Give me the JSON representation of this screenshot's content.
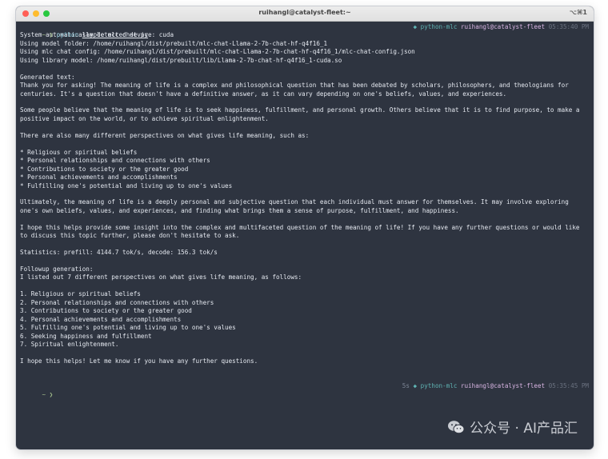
{
  "window": {
    "title": "ruihangl@catalyst-fleet:~",
    "shortcut": "⌥⌘1"
  },
  "prompt1": {
    "arrow": "~ ❯",
    "command": "python",
    "file": "sample_mlc_chat.py",
    "venv": "python-mlc",
    "user_host": "ruihangl@catalyst-fleet",
    "time": "05:35:40 PM"
  },
  "output": {
    "detect": "System automatically detected device: cuda",
    "model_folder": "Using model folder: /home/ruihangl/dist/prebuilt/mlc-chat-Llama-2-7b-chat-hf-q4f16_1",
    "chat_config": "Using mlc chat config: /home/ruihangl/dist/prebuilt/mlc-chat-Llama-2-7b-chat-hf-q4f16_1/mlc-chat-config.json",
    "library_model": "Using library model: /home/ruihangl/dist/prebuilt/lib/Llama-2-7b-chat-hf-q4f16_1-cuda.so",
    "generated_header": "Generated text:",
    "para1": "Thank you for asking! The meaning of life is a complex and philosophical question that has been debated by scholars, philosophers, and theologians for centuries. It's a question that doesn't have a definitive answer, as it can vary depending on one's beliefs, values, and experiences.",
    "para2": "Some people believe that the meaning of life is to seek happiness, fulfillment, and personal growth. Others believe that it is to find purpose, to make a positive impact on the world, or to achieve spiritual enlightenment.",
    "para3": "There are also many different perspectives on what gives life meaning, such as:",
    "bullets": [
      "* Religious or spiritual beliefs",
      "* Personal relationships and connections with others",
      "* Contributions to society or the greater good",
      "* Personal achievements and accomplishments",
      "* Fulfilling one's potential and living up to one's values"
    ],
    "para4": "Ultimately, the meaning of life is a deeply personal and subjective question that each individual must answer for themselves. It may involve exploring one's own beliefs, values, and experiences, and finding what brings them a sense of purpose, fulfillment, and happiness.",
    "para5": "I hope this helps provide some insight into the complex and multifaceted question of the meaning of life! If you have any further questions or would like to discuss this topic further, please don't hesitate to ask.",
    "statistics": "Statistics: prefill: 4144.7 tok/s, decode: 156.3 tok/s",
    "followup_header": "Followup generation:",
    "followup_intro": "I listed out 7 different perspectives on what gives life meaning, as follows:",
    "numbered": [
      "1. Religious or spiritual beliefs",
      "2. Personal relationships and connections with others",
      "3. Contributions to society or the greater good",
      "4. Personal achievements and accomplishments",
      "5. Fulfilling one's potential and living up to one's values",
      "6. Seeking happiness and fulfillment",
      "7. Spiritual enlightenment."
    ],
    "closing": "I hope this helps! Let me know if you have any further questions."
  },
  "prompt2": {
    "arrow": "~ ❯",
    "elapsed": "5s",
    "venv": "python-mlc",
    "user_host": "ruihangl@catalyst-fleet",
    "time": "05:35:45 PM"
  },
  "watermark": {
    "text": "公众号 · AI产品汇",
    "icon": "wechat-icon"
  }
}
